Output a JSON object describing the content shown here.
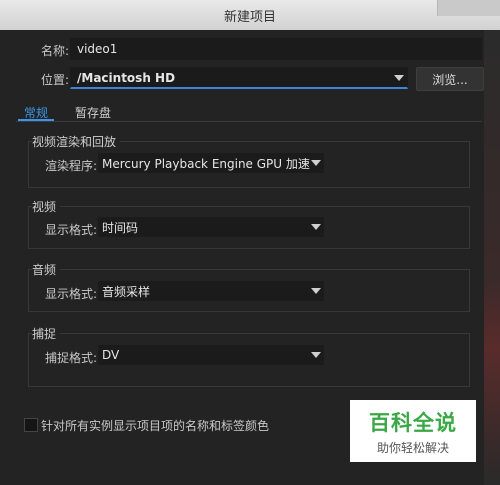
{
  "window": {
    "title": "新建项目"
  },
  "name_field": {
    "label": "名称:",
    "value": "video1"
  },
  "location_field": {
    "label": "位置:",
    "value": "/Macintosh HD",
    "browse_label": "浏览..."
  },
  "tabs": [
    {
      "label": "常规",
      "active": true
    },
    {
      "label": "暂存盘",
      "active": false
    }
  ],
  "sections": {
    "render": {
      "title": "视频渲染和回放",
      "field_label": "渲染程序:",
      "value": "Mercury Playback Engine GPU 加速 (OpenCL)"
    },
    "video": {
      "title": "视频",
      "field_label": "显示格式:",
      "value": "时间码"
    },
    "audio": {
      "title": "音频",
      "field_label": "显示格式:",
      "value": "音频采样"
    },
    "capture": {
      "title": "捕捉",
      "field_label": "捕捉格式:",
      "value": "DV"
    }
  },
  "checkbox": {
    "label": "针对所有实例显示项目项的名称和标签颜色",
    "checked": false
  },
  "watermark": {
    "title": "百科全说",
    "subtitle": "助你轻松解决"
  },
  "colors": {
    "accent": "#3c96e6",
    "background": "#232323",
    "field": "#1b1b1b",
    "watermark_green": "#39a845"
  }
}
